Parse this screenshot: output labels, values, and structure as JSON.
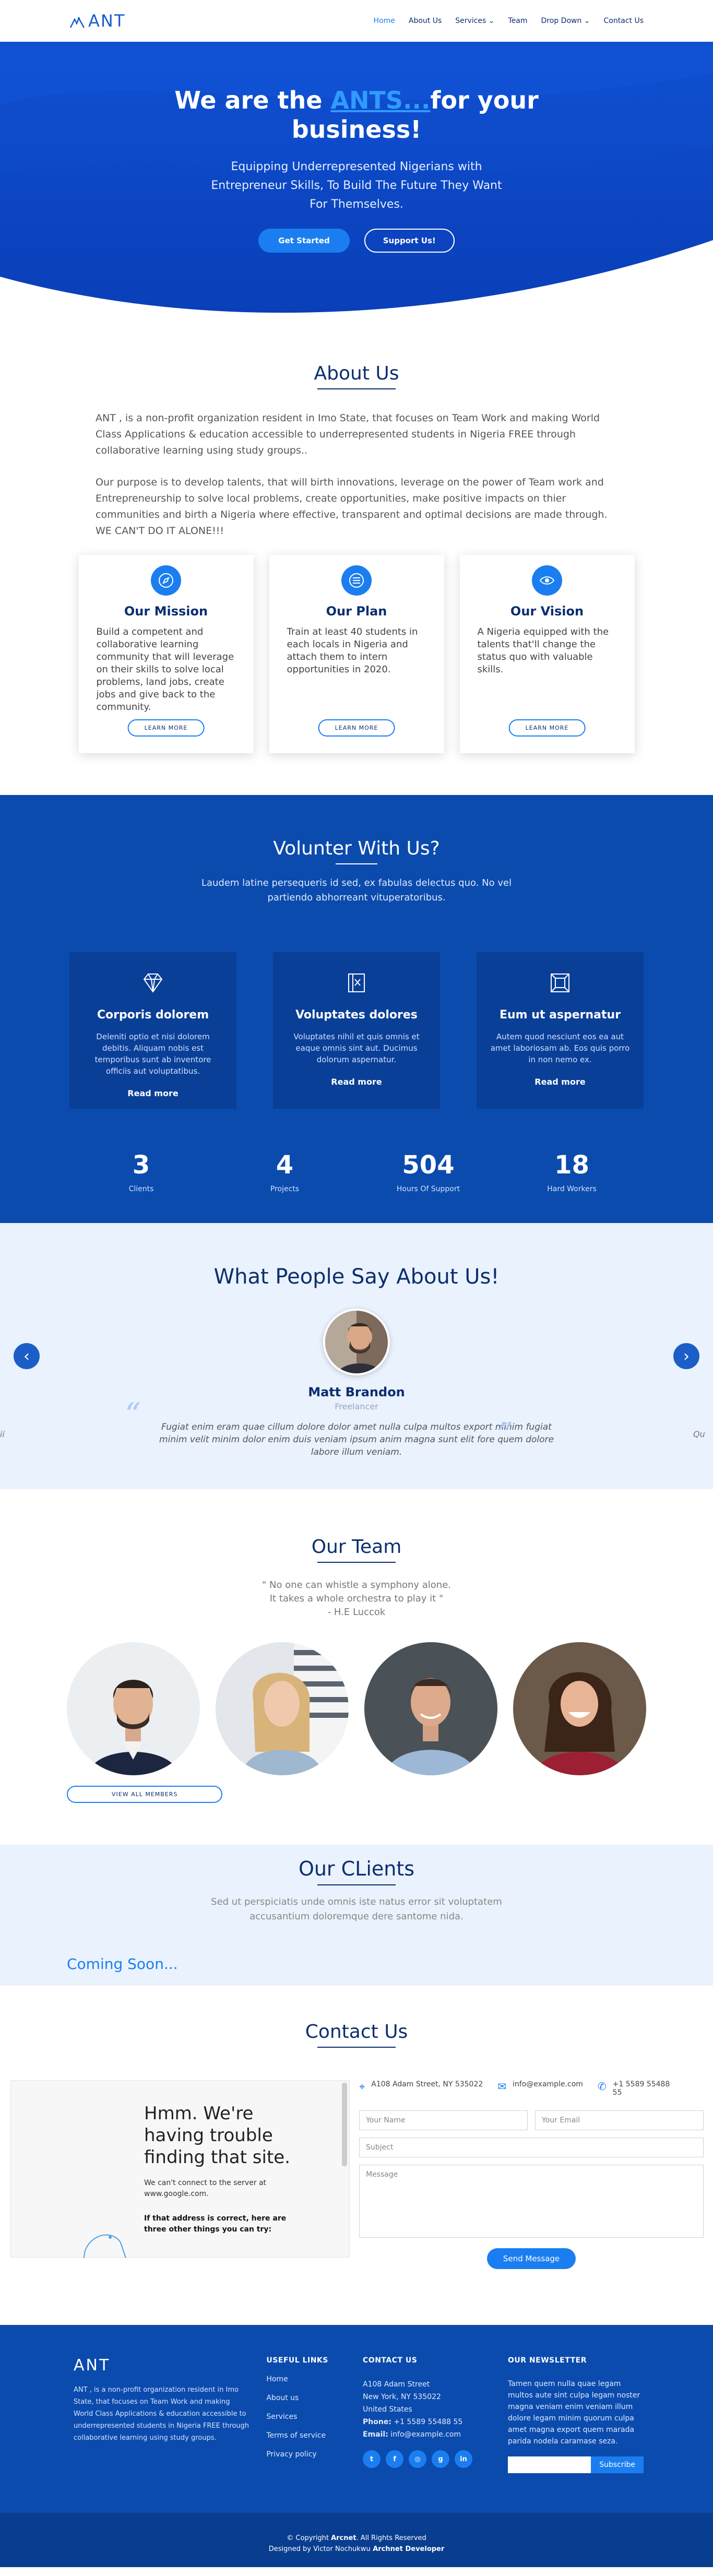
{
  "brand": {
    "name": "ANT",
    "accent": "#1b7ef0",
    "primary_dark": "#0b4bad",
    "title_color": "#0b2e6e"
  },
  "nav": {
    "items": [
      "Home",
      "About Us",
      "Services",
      "Team",
      "Drop Down",
      "Contact Us"
    ],
    "services_icon": "chevron-down-icon",
    "dropdown_icon": "chevron-down-icon"
  },
  "hero": {
    "title_pre": "We are the ",
    "title_highlight": "ANTS...",
    "title_post": "for your business!",
    "subtitle": "Equipping Underrepresented Nigerians with Entrepreneur Skills, To Build The Future They Want For Themselves.",
    "btn_start": "Get Started",
    "btn_support": "Support Us!"
  },
  "about": {
    "title": "About Us",
    "p1": "ANT , is a non-profit organization resident in Imo State, that focuses on Team Work and making World Class Applications & education accessible to underrepresented students in Nigeria FREE through collaborative learning using study groups..",
    "p2": "Our purpose is to develop talents, that will birth innovations, leverage on the power of Team work and Entrepreneurship to solve local problems, create opportunities, make positive impacts on thier communities and birth a Nigeria where effective, transparent and optimal decisions are made through. WE CAN'T DO IT ALONE!!!",
    "cards": [
      {
        "title": "Our Mission",
        "text": "Build a competent and collaborative learning community that will leverage on their skills to solve local problems, land jobs, create jobs and give back to the community.",
        "btn": "LEARN MORE",
        "icon": "compass-icon"
      },
      {
        "title": "Our Plan",
        "text": "Train at least 40 students in each locals in Nigeria and attach them to intern opportunities in 2020.",
        "btn": "LEARN MORE",
        "icon": "list-icon"
      },
      {
        "title": "Our Vision",
        "text": "A Nigeria equipped with the talents that'll change the status quo with valuable skills.",
        "btn": "LEARN MORE",
        "icon": "eye-icon"
      }
    ]
  },
  "volunteer": {
    "title": "Volunter With Us?",
    "subtitle": "Laudem latine persequeris id sed, ex fabulas delectus quo. No vel partiendo abhorreant vituperatoribus.",
    "cards": [
      {
        "title": "Corporis dolorem",
        "text": "Deleniti optio et nisi dolorem debitis. Aliquam nobis est temporibus sunt ab inventore officiis aut voluptatibus.",
        "link": "Read more",
        "icon": "diamond-icon"
      },
      {
        "title": "Voluptates dolores",
        "text": "Voluptates nihil et quis omnis et eaque omnis sint aut. Ducimus dolorum aspernatur.",
        "link": "Read more",
        "icon": "book-icon"
      },
      {
        "title": "Eum ut aspernatur",
        "text": "Autem quod nesciunt eos ea aut amet laboriosam ab. Eos quis porro in non nemo ex.",
        "link": "Read more",
        "icon": "frame-icon"
      }
    ],
    "stats": [
      {
        "num": "3",
        "label": "Clients"
      },
      {
        "num": "4",
        "label": "Projects"
      },
      {
        "num": "504",
        "label": "Hours Of Support"
      },
      {
        "num": "18",
        "label": "Hard Workers"
      }
    ]
  },
  "testimonials": {
    "title": "What People Say About Us!",
    "name": "Matt Brandon",
    "role": "Freelancer",
    "quote": "Fugiat enim eram quae cillum dolore dolor amet nulla culpa multos export minim fugiat minim velit minim dolor enim duis veniam ipsum anim magna sunt elit fore quem dolore labore illum veniam.",
    "edge_left": "ii",
    "edge_right": "Qu"
  },
  "team": {
    "title": "Our Team",
    "quote_line1": "\" No one can whistle a symphony alone.",
    "quote_line2": "It takes a whole orchestra to play it \"",
    "quote_author": "- H.E Luccok",
    "view_all": "VIEW ALL MEMBERS"
  },
  "clients": {
    "title": "Our CLients",
    "subtitle": "Sed ut perspiciatis unde omnis iste natus error sit voluptatem accusantium doloremque dere santome nida.",
    "coming": "Coming Soon..."
  },
  "contact": {
    "title": "Contact Us",
    "frame_title": "Hmm. We're having trouble finding that site.",
    "frame_p1": "We can't connect to the server at www.google.com.",
    "frame_p2": "If that address is correct, here are three other things you can try:",
    "address": "A108 Adam Street, NY 535022",
    "email": "info@example.com",
    "phone": "+1 5589 55488 55",
    "placeholders": {
      "name": "Your Name",
      "email": "Your Email",
      "subject": "Subject",
      "message": "Message"
    },
    "send": "Send Message"
  },
  "footer": {
    "logo": "ANT",
    "about": "ANT , is a non-profit organization resident in Imo State, that focuses on Team Work and making World Class Applications & education accessible to underrepresented students in Nigeria FREE through collaborative learning using study groups.",
    "links_title": "USEFUL LINKS",
    "links": [
      "Home",
      "About us",
      "Services",
      "Terms of service",
      "Privacy policy"
    ],
    "contact_title": "CONTACT US",
    "addr1": "A108 Adam Street",
    "addr2": "New York, NY 535022",
    "addr3": "United States",
    "phone_label": "Phone:",
    "phone": "+1 5589 55488 55",
    "email_label": "Email:",
    "email": "info@example.com",
    "socials": [
      "twitter-icon",
      "facebook-icon",
      "instagram-icon",
      "google-plus-icon",
      "linkedin-icon"
    ],
    "news_title": "OUR NEWSLETTER",
    "news_text": "Tamen quem nulla quae legam multos aute sint culpa legam noster magna veniam enim veniam illum dolore legam minim quorum culpa amet magna export quem marada parida nodela caramase seza.",
    "subscribe": "Subscribe",
    "copy_pre": "© Copyright ",
    "copy_brand": "Arcnet",
    "copy_post": ". All Rights Reserved",
    "design_pre": "Designed by ",
    "design_name": "Victor Nochukwu",
    "design_post": " Archnet Developer"
  }
}
